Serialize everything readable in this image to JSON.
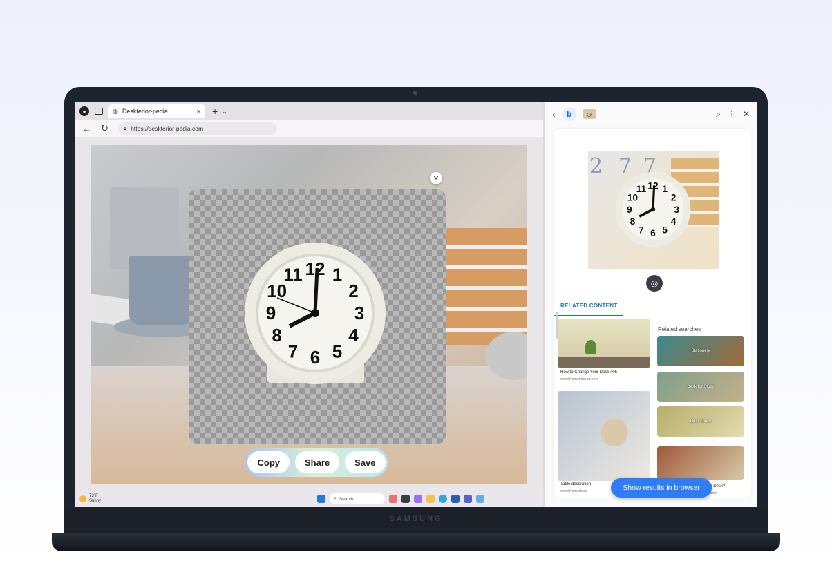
{
  "browser": {
    "tab_title": "Deskterior-pedia",
    "url": "https://deskterior-pedia.com",
    "new_tab": "+",
    "tab_menu": "⌄",
    "close_tab": "✕"
  },
  "cutout": {
    "close": "✕",
    "clock_numbers": [
      "12",
      "1",
      "2",
      "3",
      "4",
      "5",
      "6",
      "7",
      "8",
      "9",
      "10",
      "11"
    ]
  },
  "actions": {
    "copy": "Copy",
    "share": "Share",
    "save": "Save"
  },
  "taskbar": {
    "weather_temp": "73°F",
    "weather_desc": "Sunny",
    "search": "Search"
  },
  "panel": {
    "related_content_tab": "RELATED CONTENT",
    "preview_numbers": [
      "2",
      "7",
      "7"
    ],
    "results": [
      {
        "caption": "How to Change Your Desk #05",
        "source": "www.homeinterior.com"
      },
      {
        "caption": "Table decoration",
        "source": "www.homedeco"
      }
    ],
    "related_searches_title": "Related searches",
    "related_searches": [
      {
        "label": "Stationery"
      },
      {
        "label": "Desk for Study"
      },
      {
        "label": "Desk Clock"
      },
      {
        "label": "Clean Desk?",
        "source": "ids.com"
      }
    ],
    "show_results_button": "Show results in browser"
  },
  "laptop": {
    "brand": "SAMSUNG"
  },
  "colors": {
    "accent": "#2f7cf6",
    "tab_accent": "#1c6fd1"
  }
}
